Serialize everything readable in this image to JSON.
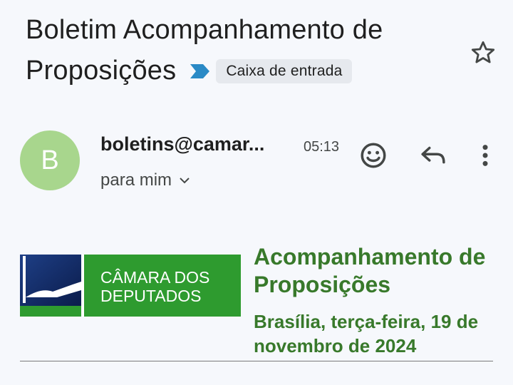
{
  "email": {
    "subject_line1": "Boletim Acompanhamento de",
    "subject_line2": "Proposições",
    "label": "Caixa de entrada",
    "sender_initial": "B",
    "sender": "boletins@camar...",
    "time": "05:13",
    "recipient": "para mim"
  },
  "icons": {
    "star": "star-icon",
    "label_arrow": "label-arrow-icon",
    "expand": "chevron-down-icon",
    "react": "emoji-icon",
    "reply": "reply-icon",
    "more": "more-vert-icon"
  },
  "body": {
    "logo_text_line1": "CÂMARA DOS",
    "logo_text_line2": "DEPUTADOS",
    "heading": "Acompanhamento de Proposições",
    "date": "Brasília, terça-feira, 19 de novembro de 2024"
  },
  "colors": {
    "background": "#f6f8fc",
    "avatar": "#a8d68d",
    "brand_green": "#38792b",
    "banner_green": "#2e9b2f",
    "label_arrow": "#2a8ac6"
  }
}
